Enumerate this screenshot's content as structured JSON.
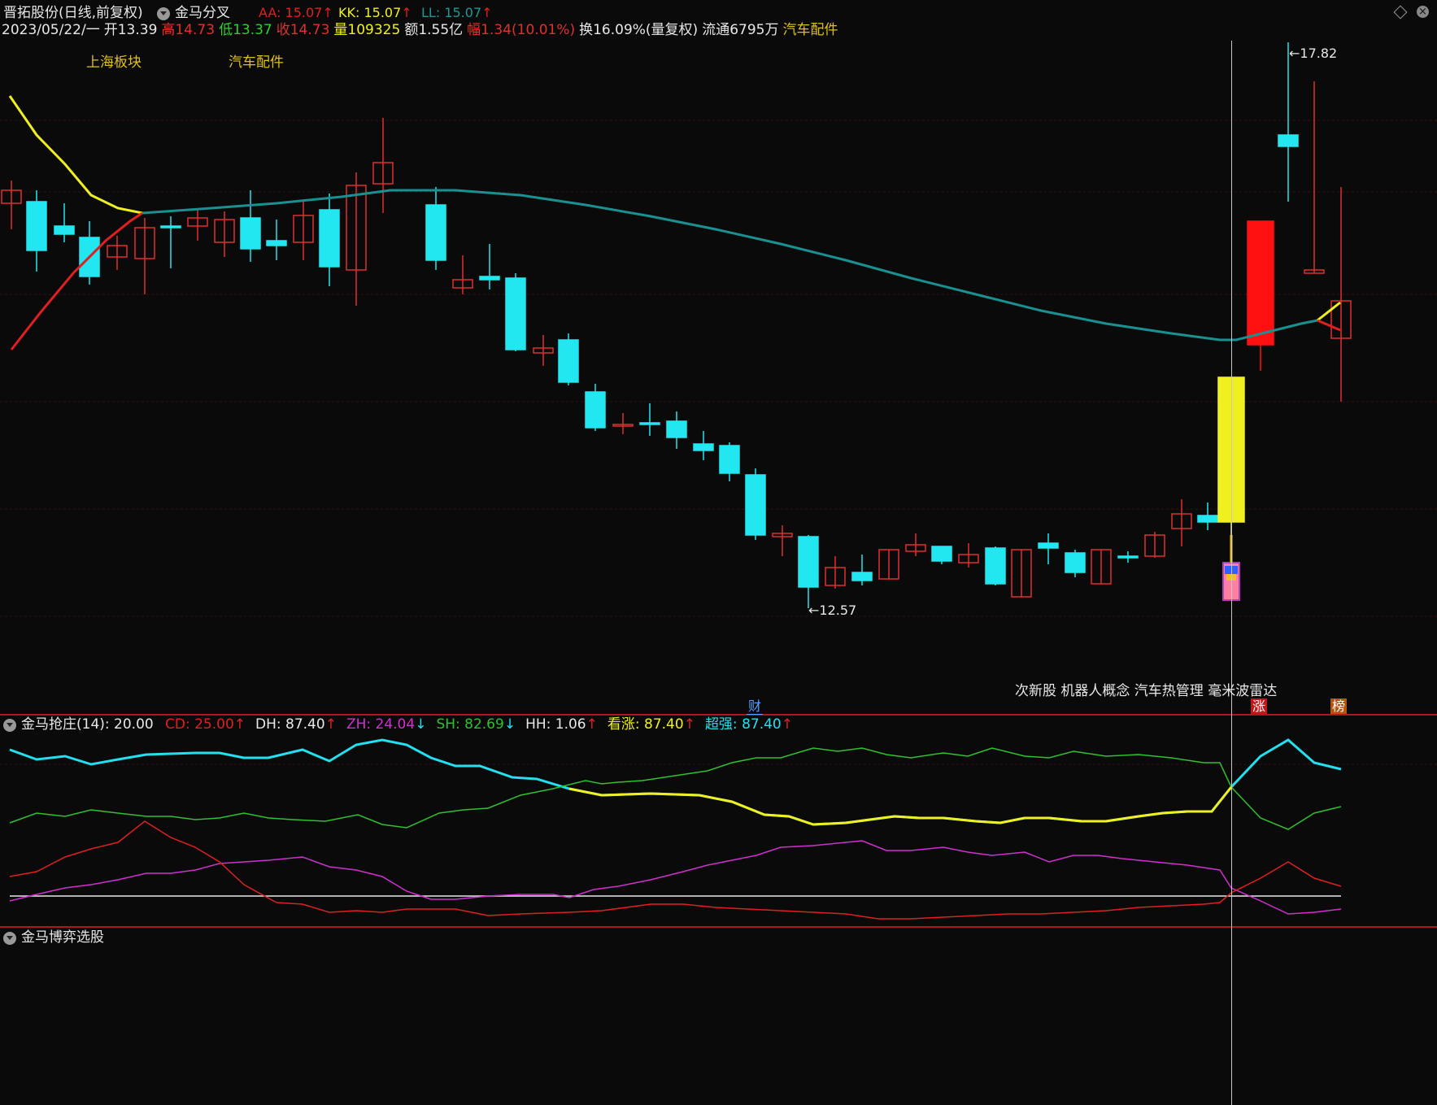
{
  "header": {
    "stock_title": "晋拓股份(日线,前复权)",
    "indicator_name": "金马分叉",
    "aa": {
      "label": "AA:",
      "value": "15.07",
      "arrow": "↑"
    },
    "kk": {
      "label": "KK:",
      "value": "15.07",
      "arrow": "↑"
    },
    "ll": {
      "label": "LL:",
      "value": "15.07",
      "arrow": "↑"
    }
  },
  "info_bar": {
    "date": "2023/05/22/一",
    "open_label": "开",
    "open": "13.39",
    "high_label": "高",
    "high": "14.73",
    "low_label": "低",
    "low": "13.37",
    "close_label": "收",
    "close": "14.73",
    "vol_label": "量",
    "vol": "109325",
    "amount_label": "额",
    "amount": "1.55亿",
    "range_label": "幅",
    "range": "1.34(10.01%)",
    "turnover": "换16.09%(量复权)",
    "float": "流通6795万",
    "sector": "汽车配件"
  },
  "sector_tags": [
    "上海板块",
    "汽车配件"
  ],
  "price_labels": {
    "high": "17.82",
    "low": "12.57"
  },
  "concepts": "次新股 机器人概念 汽车热管理 毫米波雷达",
  "badges": {
    "cai": "财",
    "zhang": "涨",
    "bang": "榜"
  },
  "sub1": {
    "title": "金马抢庄(14)",
    "param": ": 20.00",
    "items": [
      {
        "label": "CD:",
        "value": "25.00",
        "arrow": "↑",
        "color": "#e02020"
      },
      {
        "label": "DH:",
        "value": "87.40",
        "arrow": "↑",
        "color": "#e8e8e8"
      },
      {
        "label": "ZH:",
        "value": "24.04",
        "arrow": "↓",
        "color": "#d030d0"
      },
      {
        "label": "SH:",
        "value": "82.69",
        "arrow": "↓",
        "color": "#30c030"
      },
      {
        "label": "HH:",
        "value": "1.06",
        "arrow": "↑",
        "color": "#e8e8e8"
      },
      {
        "label": "看涨:",
        "value": "87.40",
        "arrow": "↑",
        "color": "#f0f020"
      },
      {
        "label": "超强:",
        "value": "87.40",
        "arrow": "↑",
        "color": "#22e0f0"
      }
    ]
  },
  "sub2": {
    "title": "金马博弈选股"
  },
  "colors": {
    "up": "#e03030",
    "down": "#22e6f0",
    "yellow": "#f0f020",
    "ma_teal": "#1a9090",
    "green": "#30c030",
    "magenta": "#d030d0",
    "red": "#e02020"
  }
}
